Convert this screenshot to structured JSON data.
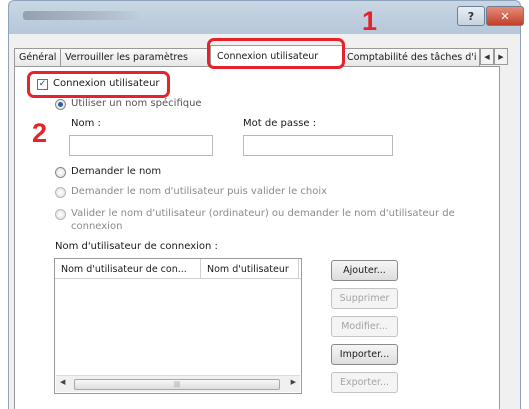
{
  "window": {
    "title_obscured": true
  },
  "titlebar": {
    "help_label": "?",
    "close_label": "✕"
  },
  "tabs": [
    {
      "label": "Général",
      "active": false
    },
    {
      "label": "Verrouiller les paramètres",
      "active": false
    },
    {
      "label": "Connexion utilisateur",
      "active": true
    },
    {
      "label": "Comptabilité des tâches d'i",
      "active": false
    }
  ],
  "tab_scroll": {
    "left": "◀",
    "right": "▶"
  },
  "callouts": {
    "step1": "1",
    "step2": "2",
    "color": "#e4232b"
  },
  "login": {
    "checkbox_label": "Connexion utilisateur",
    "checked": true,
    "specific_name_label": "Utiliser un nom spécifique",
    "name_label": "Nom :",
    "password_label": "Mot de passe :",
    "name_value": "",
    "password_value": ""
  },
  "options": {
    "ask_name": "Demander le nom",
    "ask_name_validate": "Demander le nom d'utilisateur puis valider le choix",
    "validate_or_ask_line1": "Valider le nom d'utilisateur (ordinateur) ou demander le nom d'utilisateur de",
    "validate_or_ask_line2": "connexion"
  },
  "list": {
    "label": "Nom d'utilisateur de connexion :",
    "columns": [
      "Nom d'utilisateur de con...",
      "Nom d'utilisateur"
    ],
    "rows": [],
    "scroll_left": "◀",
    "scroll_right": "▶",
    "thumb_grip": "|||"
  },
  "buttons": {
    "add": "Ajouter...",
    "delete": "Supprimer",
    "modify": "Modifier...",
    "import": "Importer...",
    "export": "Exporter..."
  },
  "icons": {
    "checkmark": "✓"
  }
}
